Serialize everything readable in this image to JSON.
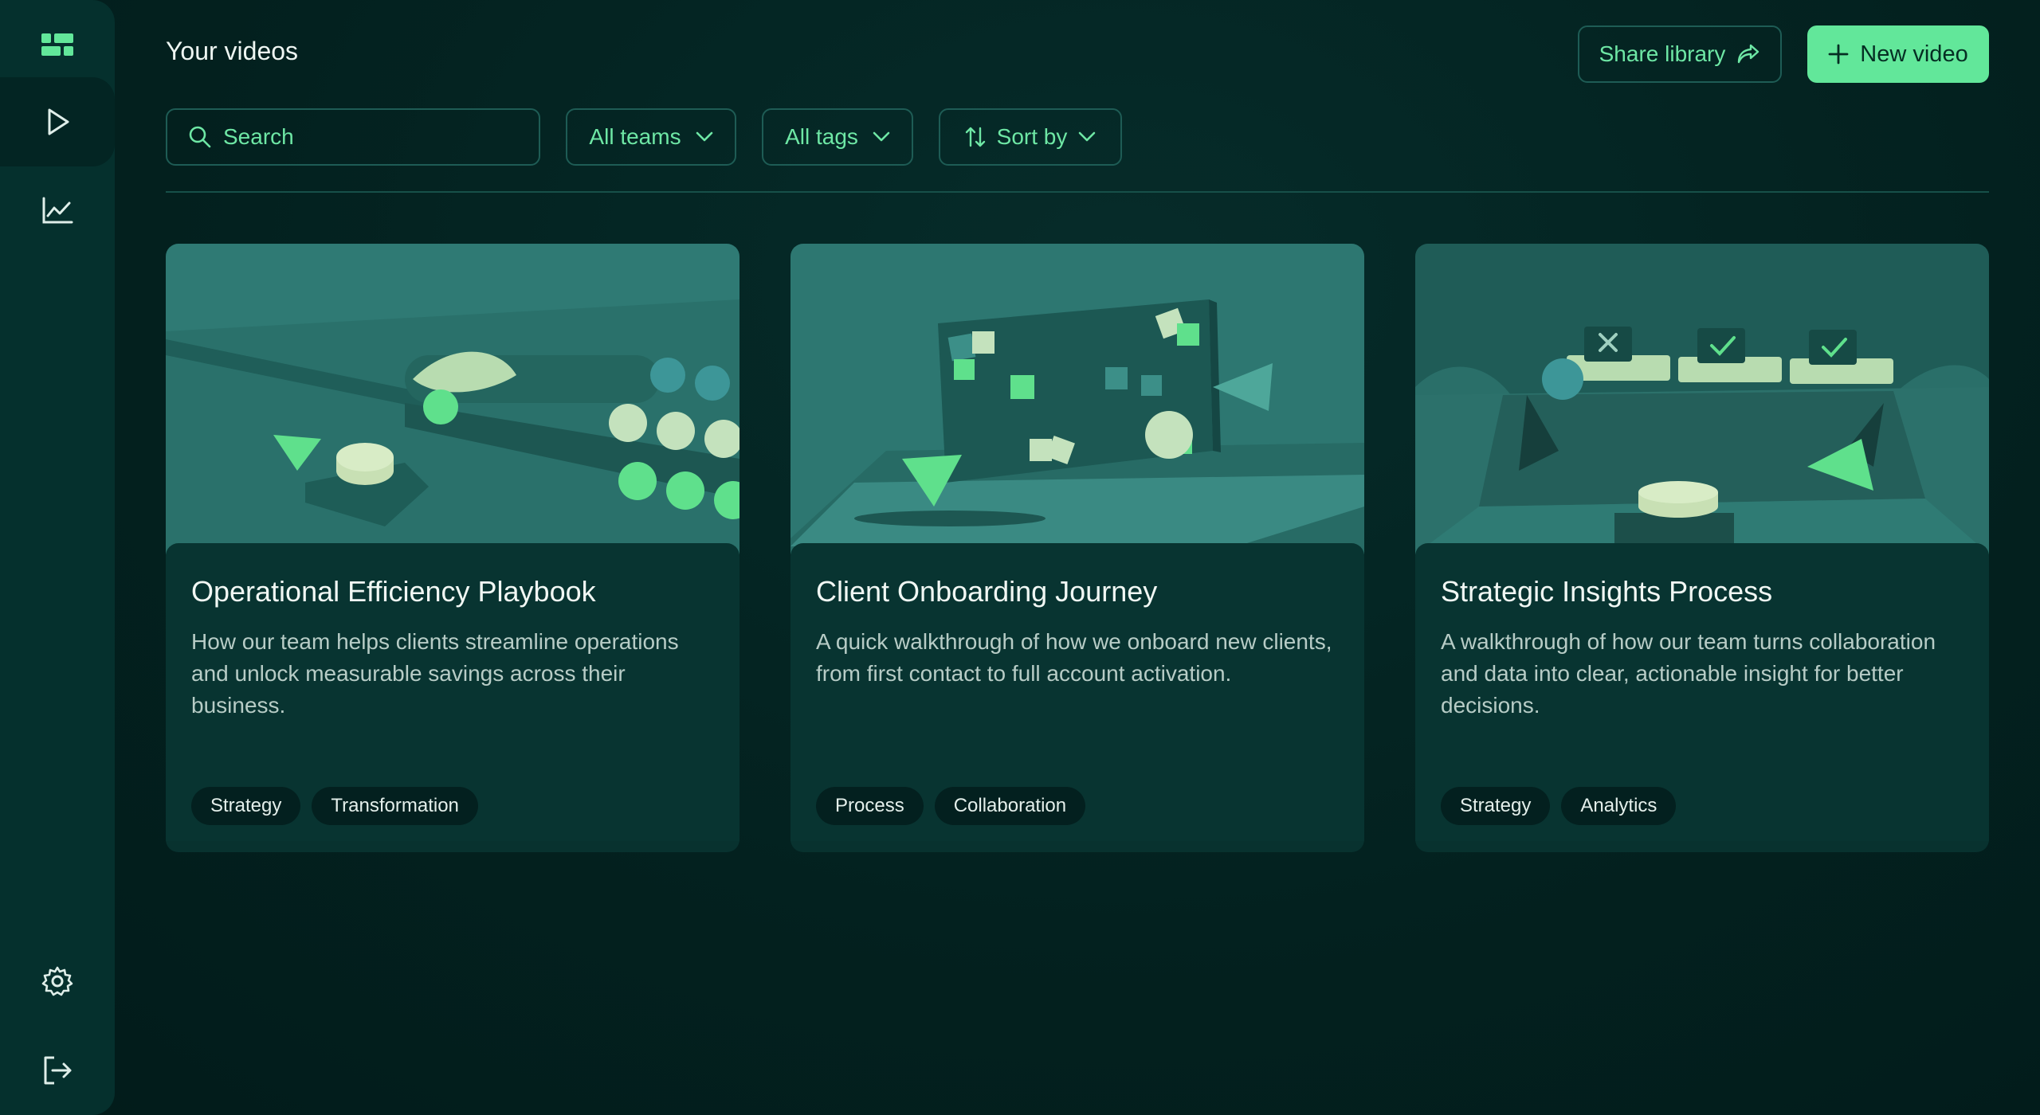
{
  "header": {
    "title": "Your videos",
    "share_label": "Share library",
    "new_label": "New video"
  },
  "filters": {
    "search_placeholder": "Search",
    "teams_label": "All teams",
    "tags_label": "All tags",
    "sort_label": "Sort by"
  },
  "sidebar": {
    "items": [
      {
        "icon": "logo-grid-icon"
      },
      {
        "icon": "play-icon",
        "active": true
      },
      {
        "icon": "chart-line-icon"
      },
      {
        "icon": "gear-icon"
      },
      {
        "icon": "logout-icon"
      }
    ]
  },
  "videos": [
    {
      "title": "Operational Efficiency Playbook",
      "description": "How our team helps clients streamline operations and unlock measurable savings across their business.",
      "tags": [
        "Strategy",
        "Transformation"
      ]
    },
    {
      "title": "Client Onboarding Journey",
      "description": "A quick walkthrough of how we onboard new clients, from first contact to full account activation.",
      "tags": [
        "Process",
        "Collaboration"
      ]
    },
    {
      "title": "Strategic Insights Process",
      "description": "A walkthrough of how our team turns collaboration and data into clear, actionable insight for better decisions.",
      "tags": [
        "Strategy",
        "Analytics"
      ]
    }
  ],
  "colors": {
    "accent": "#62e79a",
    "background": "#03201f",
    "card": "#083431"
  }
}
